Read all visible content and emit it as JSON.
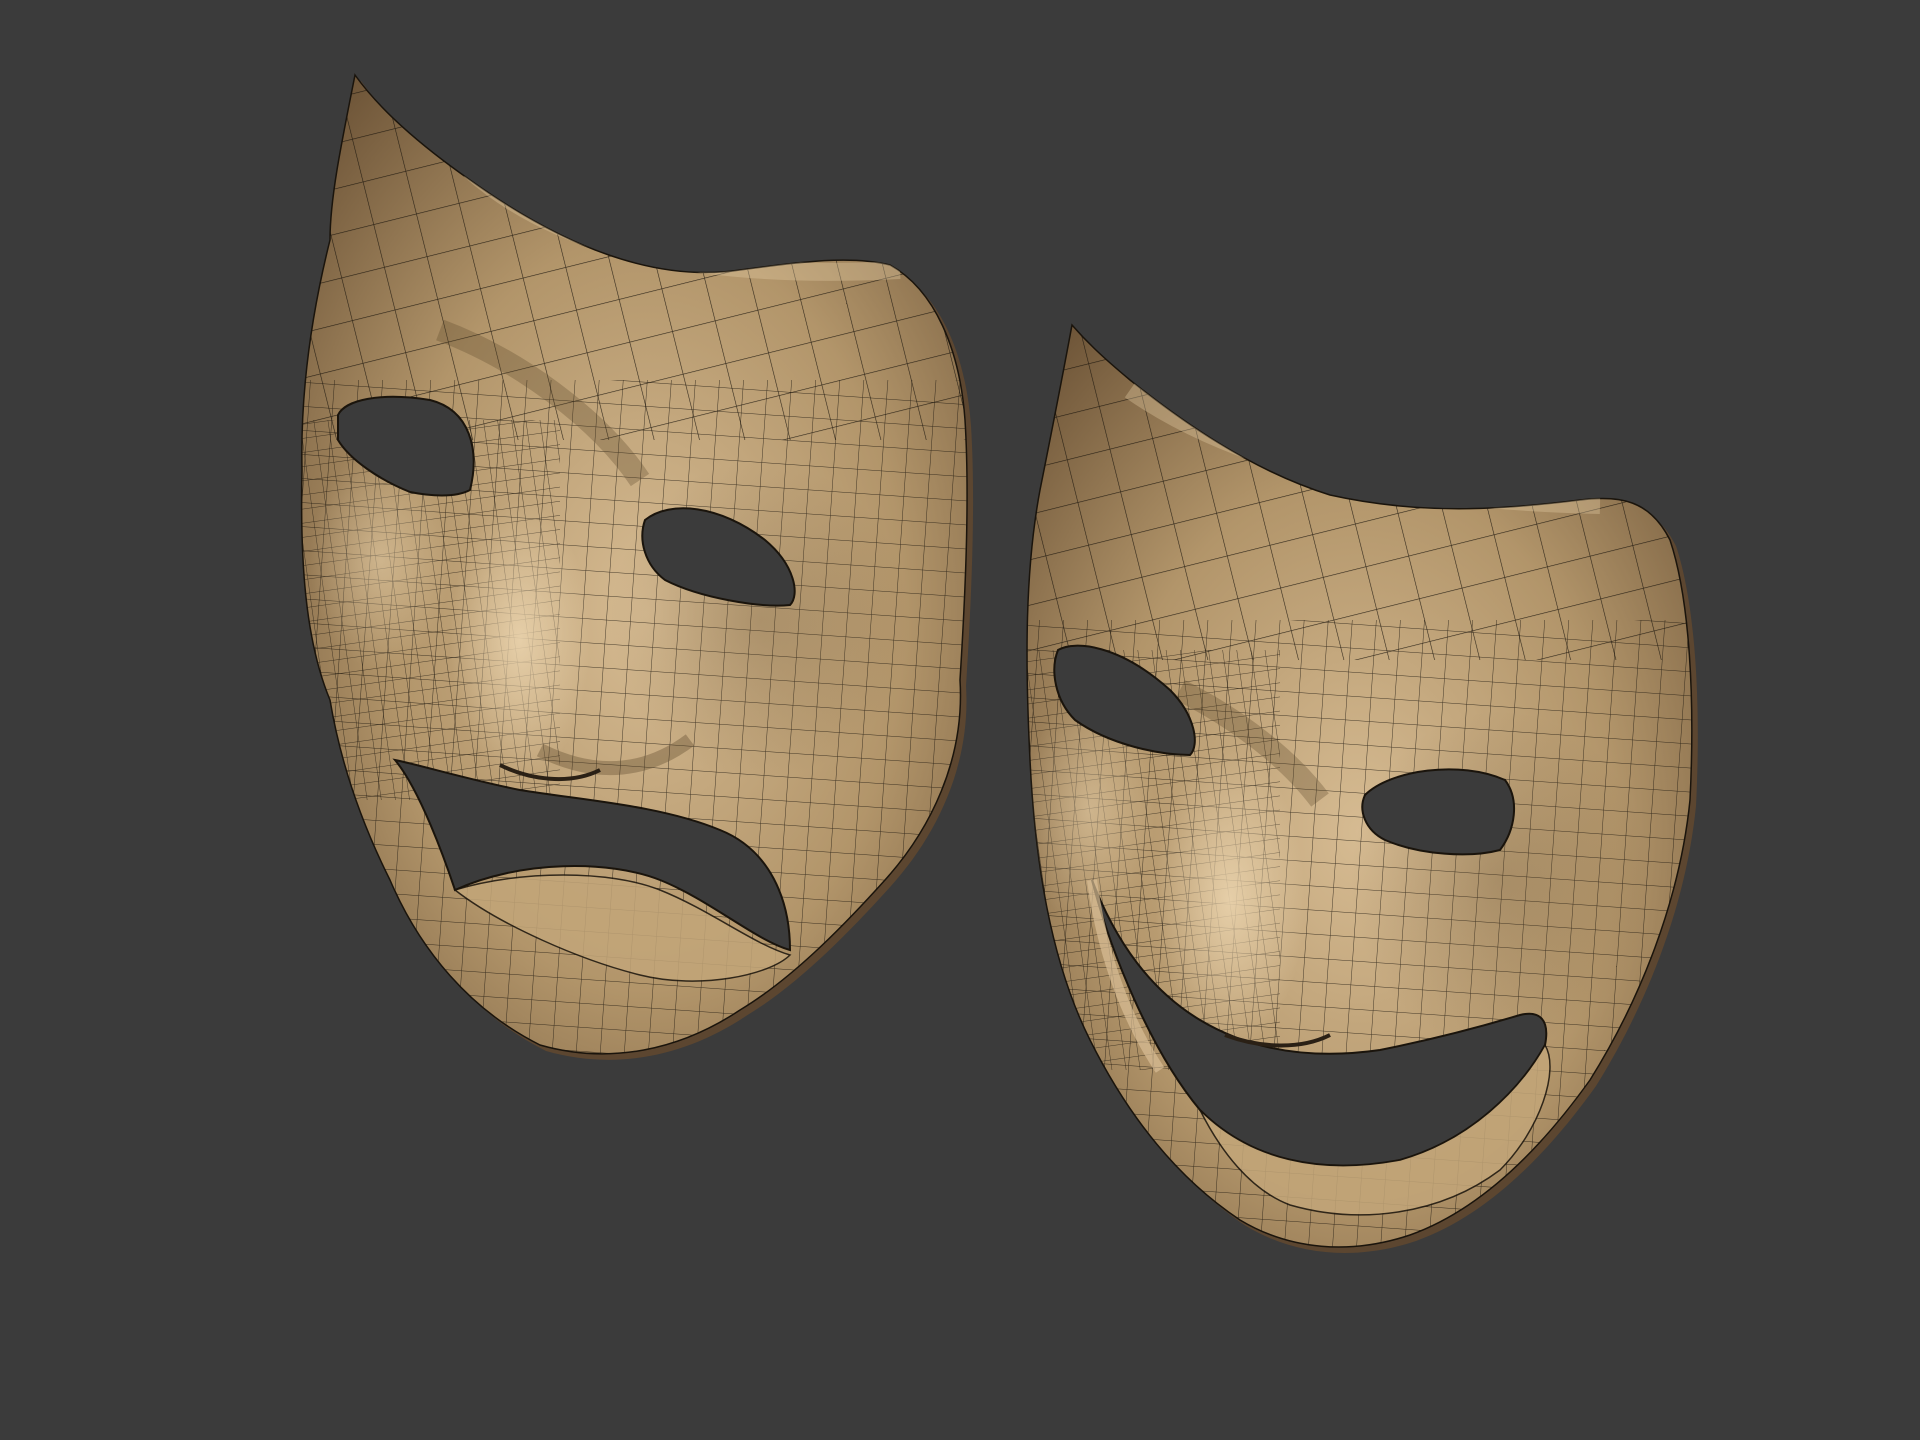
{
  "viewport": {
    "background_color": "#3b3b3b"
  },
  "objects": [
    {
      "id": "tragedy",
      "expression": "sad",
      "surface_color": "#a88a5f",
      "highlight_color": "#d2b78e",
      "shadow_color": "#6f5638",
      "wire_color": "#1a140c"
    },
    {
      "id": "comedy",
      "expression": "happy",
      "surface_color": "#a88a5f",
      "highlight_color": "#d2b78e",
      "shadow_color": "#6f5638",
      "wire_color": "#1a140c"
    }
  ]
}
